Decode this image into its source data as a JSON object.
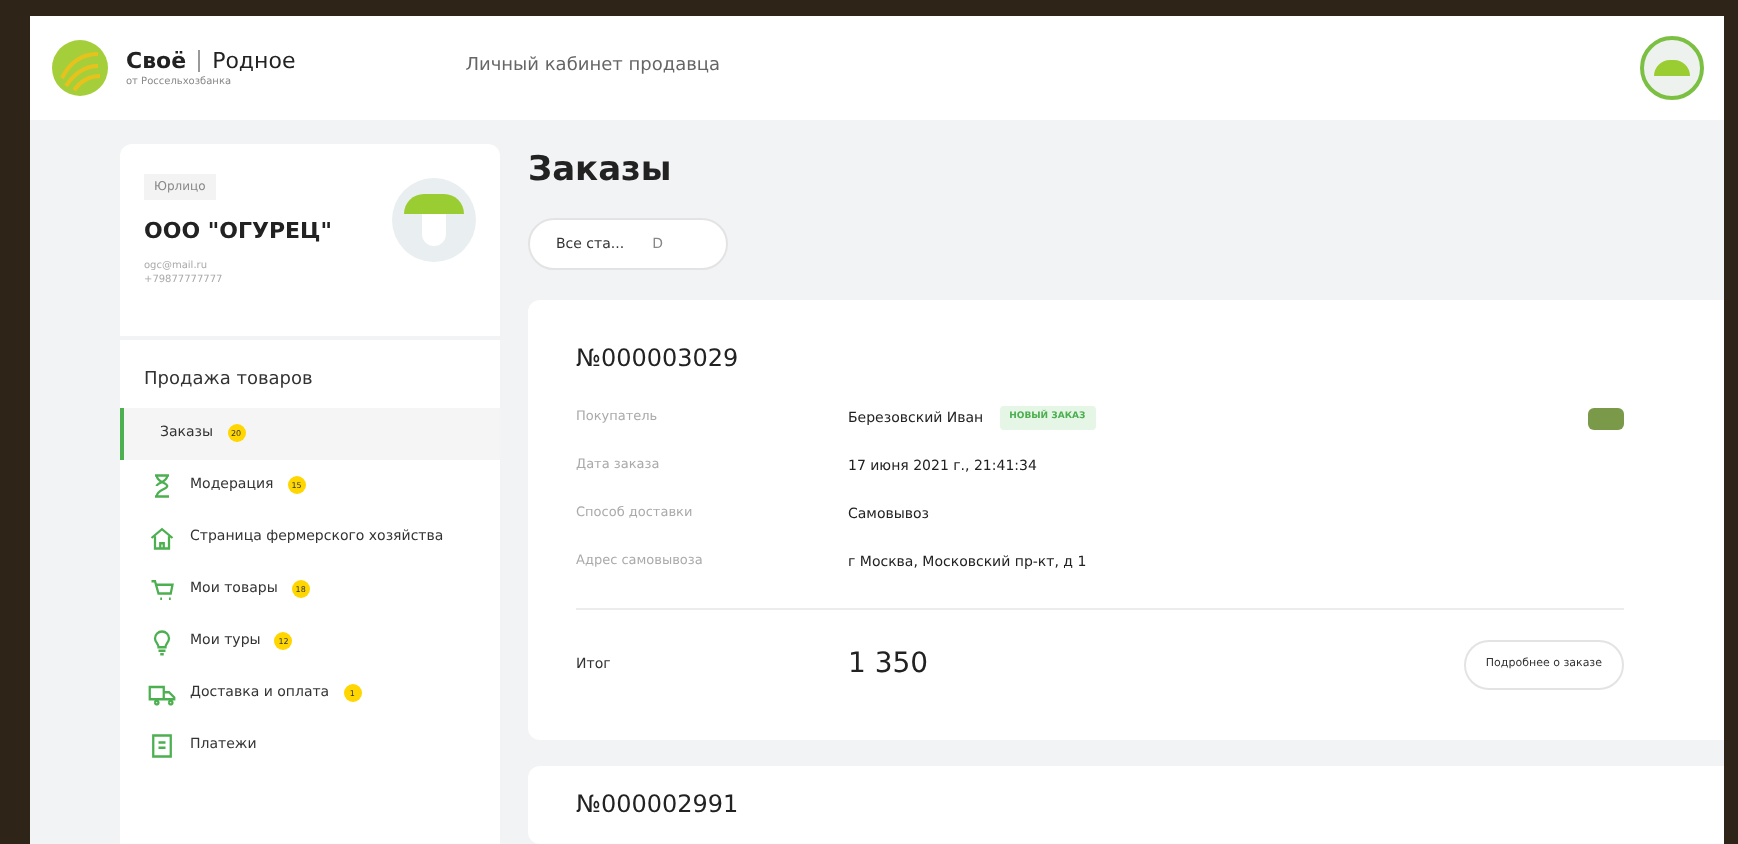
{
  "header": {
    "brand": "Своё",
    "brand_2": "Родное",
    "brand_sub": "от Россельхозбанка",
    "title": "Личный кабинет продавца"
  },
  "profile": {
    "type_label": "Юрлицо",
    "name": "ООО \"ОГУРЕЦ\"",
    "email": "ogc@mail.ru",
    "phone": "+79877777777"
  },
  "sidebar": {
    "section": "Продажа товаров",
    "items": [
      {
        "label": "Заказы",
        "badge": "20",
        "kind": "plain",
        "selected": true
      },
      {
        "label": "Модерация",
        "badge": "15",
        "kind": "moderation",
        "selected": false
      },
      {
        "label": "Страница фермерского хозяйства",
        "kind": "farm",
        "selected": false
      },
      {
        "label": "Мои товары",
        "badge": "18",
        "kind": "goods",
        "selected": false
      },
      {
        "label": "Мои туры",
        "badge": "12",
        "kind": "tours",
        "selected": false
      },
      {
        "label": "Доставка и оплата",
        "badge": "1",
        "kind": "delivery",
        "selected": false
      },
      {
        "label": "Платежи",
        "kind": "payments",
        "selected": false
      }
    ]
  },
  "page": {
    "title": "Заказы",
    "filter": "Все ста...",
    "filter_icon": "D"
  },
  "orders": [
    {
      "number": "№000003029",
      "fields": [
        {
          "label": "Покупатель",
          "value": "Березовский Иван",
          "tag": "НОВЫЙ ЗАКАЗ"
        },
        {
          "label": "Дата заказа",
          "value": "17 июня 2021 г., 21:41:34"
        },
        {
          "label": "Способ доставки",
          "value": "Самовывоз"
        },
        {
          "label": "Адрес самовывоза",
          "value": "г Москва, Московский пр-кт, д 1"
        }
      ],
      "total_label": "Итог",
      "total": "1 350",
      "details_button": "Подробнее о заказе"
    },
    {
      "number": "№000002991"
    }
  ]
}
